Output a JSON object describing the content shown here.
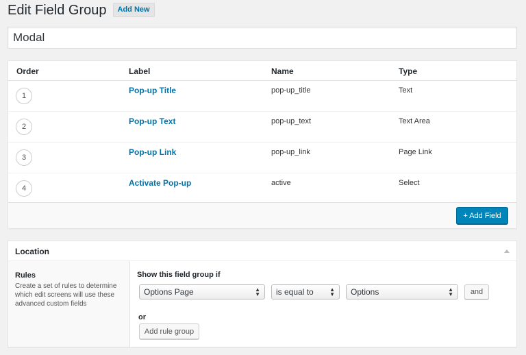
{
  "header": {
    "title": "Edit Field Group",
    "add_new": "Add New"
  },
  "group_title": "Modal",
  "fields_table": {
    "columns": [
      "Order",
      "Label",
      "Name",
      "Type"
    ],
    "rows": [
      {
        "order": "1",
        "label": "Pop-up Title",
        "name": "pop-up_title",
        "type": "Text"
      },
      {
        "order": "2",
        "label": "Pop-up Text",
        "name": "pop-up_text",
        "type": "Text Area"
      },
      {
        "order": "3",
        "label": "Pop-up Link",
        "name": "pop-up_link",
        "type": "Page Link"
      },
      {
        "order": "4",
        "label": "Activate Pop-up",
        "name": "active",
        "type": "Select"
      }
    ],
    "add_field": "+ Add Field"
  },
  "location": {
    "title": "Location",
    "rules_title": "Rules",
    "rules_desc": "Create a set of rules to determine which edit screens will use these advanced custom fields",
    "show_if": "Show this field group if",
    "param": "Options Page",
    "operator": "is equal to",
    "value": "Options",
    "and_label": "and",
    "or_label": "or",
    "add_rule_group": "Add rule group"
  },
  "colors": {
    "accent": "#0073aa",
    "primary_button": "#0085ba"
  }
}
